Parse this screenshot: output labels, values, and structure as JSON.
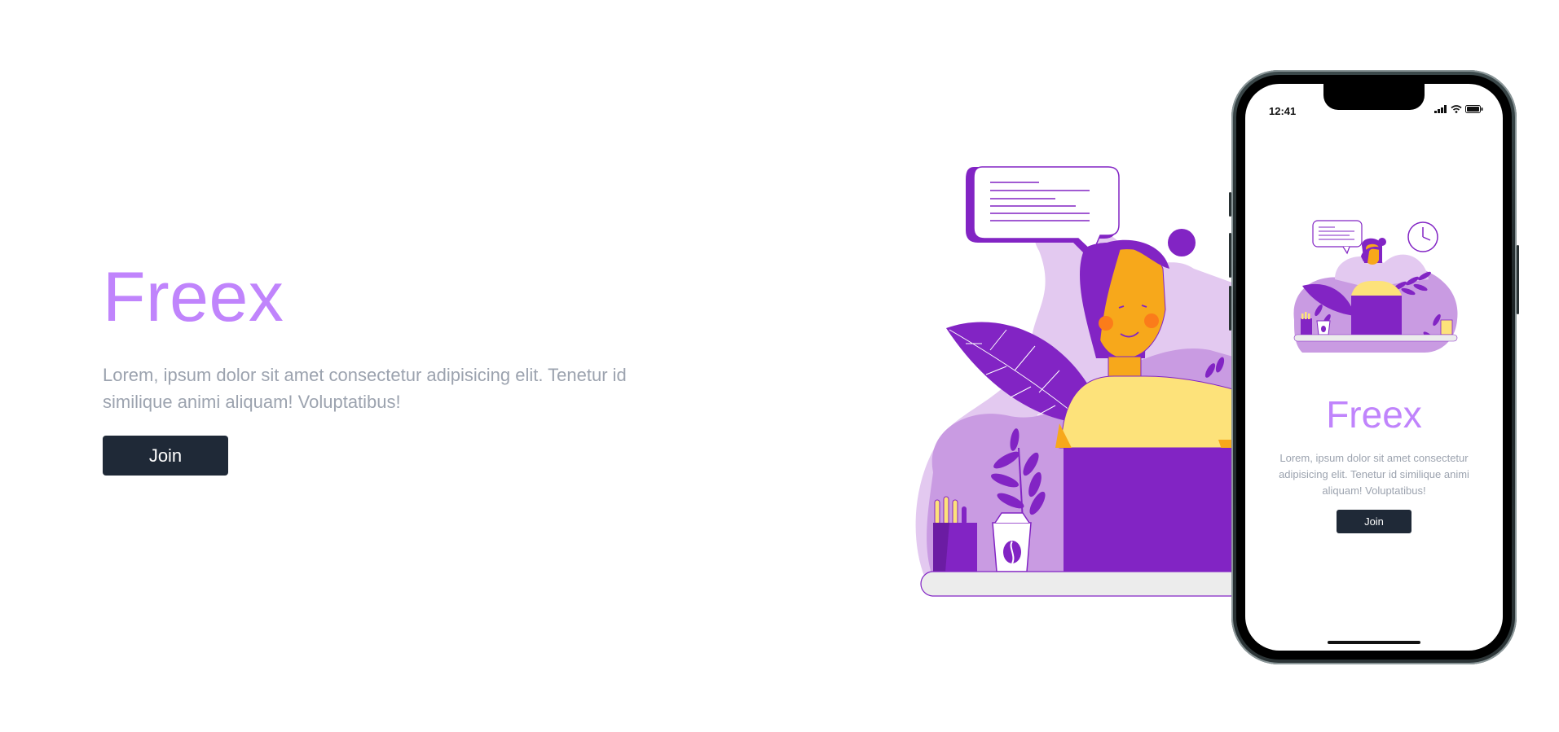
{
  "hero": {
    "title": "Freex",
    "description": "Lorem, ipsum dolor sit amet consectetur adipisicing elit. Tenetur id similique animi aliquam! Voluptatibus!",
    "join_label": "Join"
  },
  "phone": {
    "status_time": "12:41",
    "title": "Freex",
    "description": "Lorem, ipsum dolor sit amet consectetur adipisicing elit. Tenetur id similique animi aliquam! Voluptatibus!",
    "join_label": "Join"
  },
  "icons": {
    "signal": "signal-icon",
    "wifi": "wifi-icon",
    "battery": "battery-icon",
    "clock": "clock-icon",
    "coffee": "coffee-bean-icon"
  },
  "colors": {
    "accent": "#c084fc",
    "primary_purple": "#8224c4",
    "light_purple": "#e3c9f0",
    "mid_purple": "#c99be2",
    "button_dark": "#1f2937",
    "text_muted": "#9ca3af",
    "skin": "#f7a81b",
    "shirt": "#fde27a"
  }
}
